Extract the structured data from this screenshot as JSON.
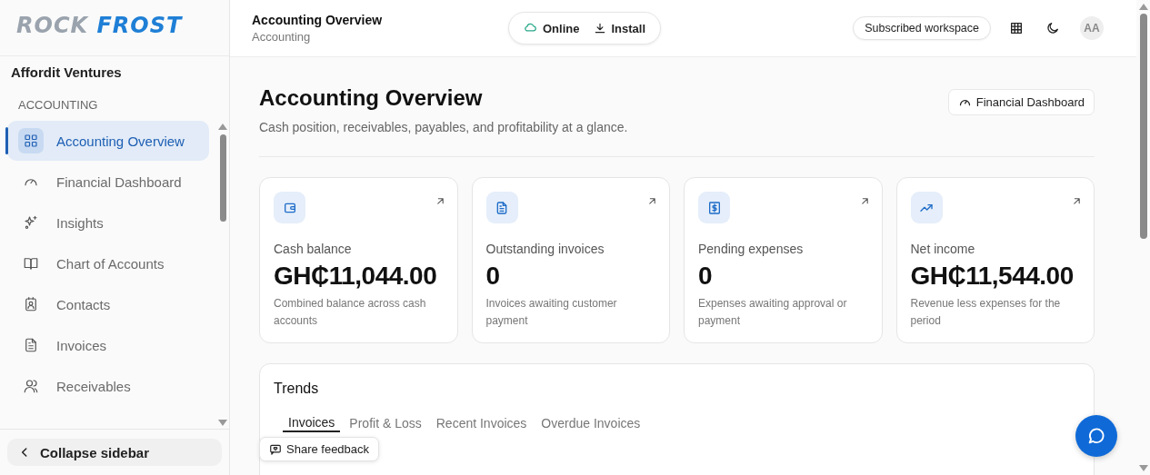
{
  "sidebar": {
    "logo": {
      "parts": [
        "ROCK",
        "FROST"
      ]
    },
    "workspace": "Affordit Ventures",
    "section": "ACCOUNTING",
    "items": [
      {
        "label": "Accounting Overview",
        "selected": true
      },
      {
        "label": "Financial Dashboard",
        "selected": false
      },
      {
        "label": "Insights",
        "selected": false
      },
      {
        "label": "Chart of Accounts",
        "selected": false
      },
      {
        "label": "Contacts",
        "selected": false
      },
      {
        "label": "Invoices",
        "selected": false
      },
      {
        "label": "Receivables",
        "selected": false
      }
    ],
    "collapse": "Collapse sidebar"
  },
  "header": {
    "title": "Accounting Overview",
    "subtitle": "Accounting",
    "status": "Online",
    "install": "Install",
    "plan": "Subscribed workspace",
    "avatar": "AA"
  },
  "page": {
    "title": "Accounting Overview",
    "description": "Cash position, receivables, payables, and profitability at a glance.",
    "action": "Financial Dashboard"
  },
  "cards": [
    {
      "label": "Cash balance",
      "value": "GH₵11,044.00",
      "note": "Combined balance across cash accounts"
    },
    {
      "label": "Outstanding invoices",
      "value": "0",
      "note": "Invoices awaiting customer payment"
    },
    {
      "label": "Pending expenses",
      "value": "0",
      "note": "Expenses awaiting approval or payment"
    },
    {
      "label": "Net income",
      "value": "GH₵11,544.00",
      "note": "Revenue less expenses for the period"
    }
  ],
  "trends": {
    "title": "Trends",
    "tabs": [
      {
        "label": "Invoices",
        "selected": true
      },
      {
        "label": "Profit & Loss",
        "selected": false
      },
      {
        "label": "Recent Invoices",
        "selected": false
      },
      {
        "label": "Overdue Invoices",
        "selected": false
      }
    ]
  },
  "feedback": "Share feedback"
}
